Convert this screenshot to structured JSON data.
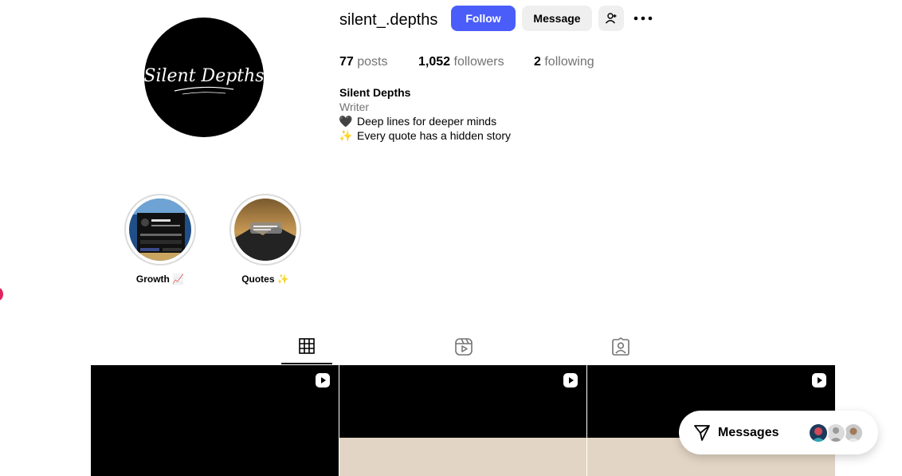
{
  "profile": {
    "username": "silent_.depths",
    "follow_label": "Follow",
    "message_label": "Message",
    "avatar_text": "Silent Depths"
  },
  "stats": {
    "posts_count": "77",
    "posts_label": "posts",
    "followers_count": "1,052",
    "followers_label": "followers",
    "following_count": "2",
    "following_label": "following"
  },
  "bio": {
    "name": "Silent Depths",
    "category": "Writer",
    "line1_emoji": "🖤",
    "line1": "Deep lines for deeper minds",
    "line2_emoji": "✨",
    "line2": "Every quote has a hidden story"
  },
  "highlights": [
    {
      "label": "Growth 📈"
    },
    {
      "label": "Quotes ✨"
    }
  ],
  "tabs": [
    "posts-grid-icon",
    "reels-icon",
    "tagged-icon"
  ],
  "messages": {
    "label": "Messages"
  },
  "colors": {
    "accent": "#4a5df9",
    "muted": "#737373",
    "button_bg": "#efefef"
  }
}
